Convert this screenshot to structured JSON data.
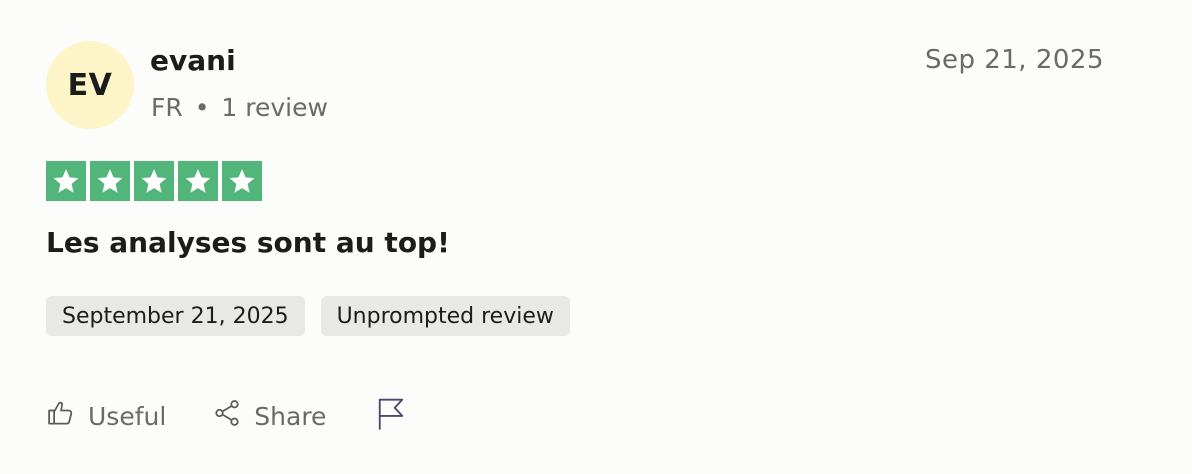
{
  "reviewer": {
    "initials": "EV",
    "name": "evani",
    "country": "FR",
    "separator": "•",
    "review_count": "1 review"
  },
  "date_posted": "Sep 21, 2025",
  "rating": {
    "value": 5,
    "max": 5,
    "color": "#52b67b"
  },
  "review": {
    "title": "Les analyses sont au top!"
  },
  "chips": {
    "experience_date": "September 21, 2025",
    "review_type": "Unprompted review"
  },
  "actions": {
    "useful_label": "Useful",
    "share_label": "Share",
    "useful_icon": "thumbs-up-icon",
    "share_icon": "share-icon",
    "report_icon": "flag-icon"
  }
}
